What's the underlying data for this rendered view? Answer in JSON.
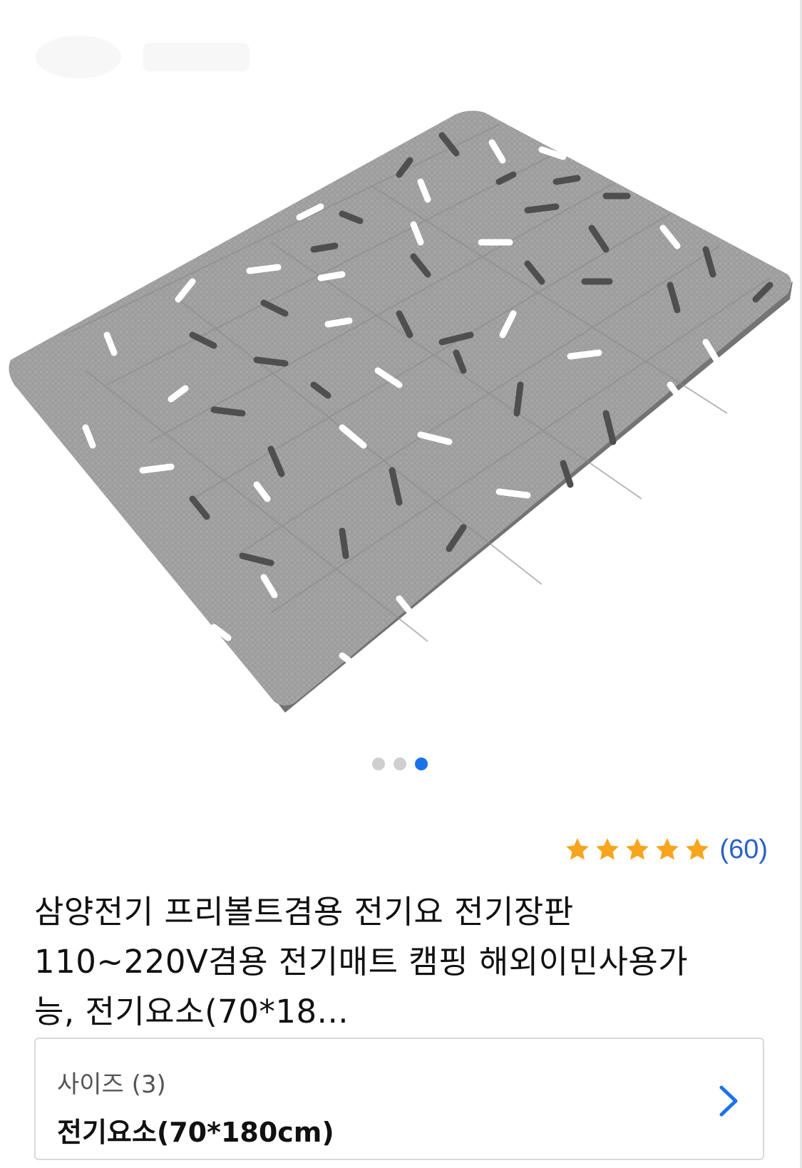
{
  "product": {
    "image_alt": "Gray quilted electric mat with scattered stick pattern",
    "carousel": {
      "count": 3,
      "active_index": 2
    },
    "rating": {
      "stars": 5,
      "count_text": "(60)",
      "star_color": "#f7a51c"
    },
    "title_lines": [
      "삼양전기 프리볼트겸용 전기요 전기장판",
      "110~220V겸용 전기매트 캠핑 해외이민사용가",
      "능, 전기요소(70*18..."
    ]
  },
  "option": {
    "label": "사이즈 (3)",
    "value": "전기요소(70*180cm)"
  },
  "colors": {
    "accent": "#1a73e8",
    "rating_text": "#2962c6",
    "mat": "#9a9a9a"
  }
}
